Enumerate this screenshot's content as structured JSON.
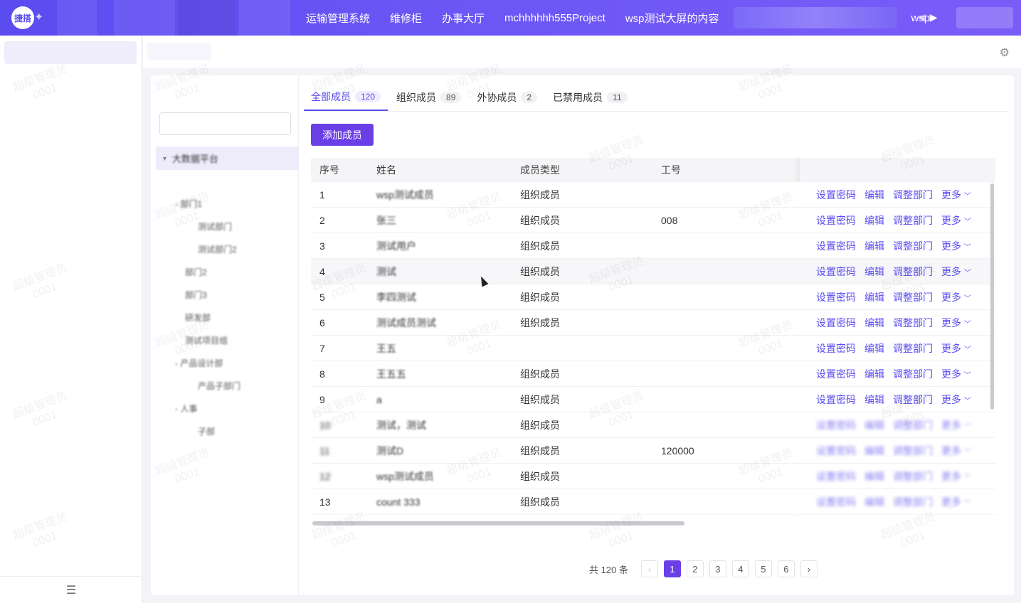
{
  "topbar": {
    "logo_text": "捷搭",
    "nav": [
      "运输管理系统",
      "维修柜",
      "办事大厅",
      "mchhhhhh555Project",
      "wsp测试大屏的内容",
      "wsp"
    ],
    "prev_icon": "caret-left-icon",
    "next_icon": "caret-right-icon"
  },
  "header": {
    "settings_icon": "gear-icon"
  },
  "tabs": [
    {
      "label": "全部成员",
      "count": "120",
      "active": true
    },
    {
      "label": "组织成员",
      "count": "89"
    },
    {
      "label": "外协成员",
      "count": "2"
    },
    {
      "label": "已禁用成员",
      "count": "11"
    }
  ],
  "toolbar": {
    "add_label": "添加成员"
  },
  "table": {
    "headers": {
      "index": "序号",
      "name": "姓名",
      "type": "成员类型",
      "number": "工号"
    },
    "ops": {
      "reset_pwd": "设置密码",
      "edit": "编辑",
      "move_dept": "调整部门",
      "more": "更多"
    },
    "rows": [
      {
        "index": "1",
        "name": "wsp测试成员",
        "type": "组织成员",
        "number": ""
      },
      {
        "index": "2",
        "name": "张三",
        "type": "组织成员",
        "number": "008"
      },
      {
        "index": "3",
        "name": "测试用户",
        "type": "组织成员",
        "number": ""
      },
      {
        "index": "4",
        "name": "测试",
        "type": "组织成员",
        "number": ""
      },
      {
        "index": "5",
        "name": "李四测试",
        "type": "组织成员",
        "number": ""
      },
      {
        "index": "6",
        "name": "测试成员测试",
        "type": "组织成员",
        "number": ""
      },
      {
        "index": "7",
        "name": "王五",
        "type": "",
        "number": ""
      },
      {
        "index": "8",
        "name": "王五五",
        "type": "组织成员",
        "number": ""
      },
      {
        "index": "9",
        "name": "a",
        "type": "组织成员",
        "number": ""
      },
      {
        "index": "10",
        "name": "测试，测试",
        "type": "组织成员",
        "number": ""
      },
      {
        "index": "11",
        "name": "测试D",
        "type": "组织成员",
        "number": "120000"
      },
      {
        "index": "12",
        "name": "wsp测试成员",
        "type": "组织成员",
        "number": ""
      },
      {
        "index": "13",
        "name": "count 333",
        "type": "组织成员",
        "number": ""
      }
    ]
  },
  "pagination": {
    "total": "共 120 条",
    "pages": [
      "1",
      "2",
      "3",
      "4",
      "5",
      "6"
    ],
    "current": "1"
  },
  "tree": {
    "root": "大数据平台",
    "nodes": [
      "部门1",
      "测试部门",
      "测试部门2",
      "部门2",
      "部门3",
      "研发部",
      "测试项目组",
      "产品设计部",
      "产品子部门",
      "人事",
      "子部"
    ]
  },
  "watermark": {
    "line1": "超级管理员",
    "line2": "0001"
  }
}
